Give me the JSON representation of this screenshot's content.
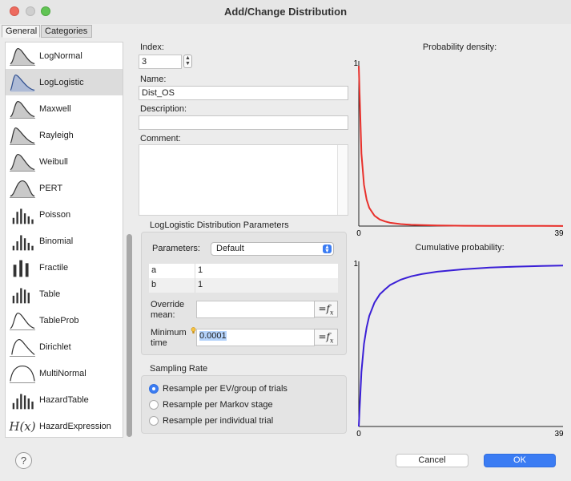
{
  "window": {
    "title": "Add/Change Distribution"
  },
  "tabs": [
    {
      "label": "General"
    },
    {
      "label": "Categories"
    }
  ],
  "distributions": [
    {
      "label": "LogNormal",
      "icon": "lognormal-curve-icon"
    },
    {
      "label": "LogLogistic",
      "icon": "loglogistic-curve-icon",
      "selected": true
    },
    {
      "label": "Maxwell",
      "icon": "maxwell-curve-icon"
    },
    {
      "label": "Rayleigh",
      "icon": "rayleigh-curve-icon"
    },
    {
      "label": "Weibull",
      "icon": "weibull-curve-icon"
    },
    {
      "label": "PERT",
      "icon": "pert-curve-icon"
    },
    {
      "label": "Poisson",
      "icon": "poisson-bars-icon"
    },
    {
      "label": "Binomial",
      "icon": "binomial-bars-icon"
    },
    {
      "label": "Fractile",
      "icon": "fractile-bars-icon"
    },
    {
      "label": "Table",
      "icon": "table-bars-icon"
    },
    {
      "label": "TableProb",
      "icon": "tableprob-curve-icon"
    },
    {
      "label": "Dirichlet",
      "icon": "dirichlet-curve-icon"
    },
    {
      "label": "MultiNormal",
      "icon": "multinormal-curve-icon"
    },
    {
      "label": "HazardTable",
      "icon": "hazardtable-bars-icon"
    },
    {
      "label": "HazardExpression",
      "icon": "hazard-expression-icon",
      "icon_text": "H(x)"
    }
  ],
  "form": {
    "index_label": "Index:",
    "index_value": "3",
    "name_label": "Name:",
    "name_value": "Dist_OS",
    "description_label": "Description:",
    "description_value": "",
    "comment_label": "Comment:",
    "comment_value": ""
  },
  "params": {
    "group_title": "LogLogistic Distribution Parameters",
    "parameters_label": "Parameters:",
    "parameters_value": "Default",
    "rows": [
      {
        "name": "a",
        "value": "1"
      },
      {
        "name": "b",
        "value": "1"
      }
    ],
    "override_mean_label_1": "Override",
    "override_mean_label_2": "mean:",
    "override_mean_value": "",
    "min_time_label_1": "Minimum",
    "min_time_label_2": "time",
    "min_time_value": "0.0001",
    "fx_label": "=fx"
  },
  "sampling": {
    "title": "Sampling Rate",
    "options": [
      {
        "label": "Resample per EV/group of trials",
        "selected": true
      },
      {
        "label": "Resample per Markov stage",
        "selected": false
      },
      {
        "label": "Resample per individual trial",
        "selected": false
      }
    ]
  },
  "chart_data": [
    {
      "type": "line",
      "title": "Probability density:",
      "xlim": [
        0,
        39
      ],
      "ylim": [
        0,
        1
      ],
      "x_tick_labels": [
        "0",
        "39"
      ],
      "y_tick_labels": [
        "1"
      ],
      "color": "#e8302b",
      "x": [
        0,
        0.5,
        1,
        1.5,
        2,
        3,
        4,
        5,
        6,
        8,
        10,
        12,
        15,
        20,
        25,
        30,
        35,
        39
      ],
      "y": [
        0.97,
        0.44,
        0.25,
        0.16,
        0.11,
        0.0625,
        0.04,
        0.028,
        0.02,
        0.012,
        0.008,
        0.006,
        0.004,
        0.002,
        0.0015,
        0.001,
        0.0008,
        0.0006
      ]
    },
    {
      "type": "line",
      "title": "Cumulative probability:",
      "xlim": [
        0,
        39
      ],
      "ylim": [
        0,
        1
      ],
      "x_tick_labels": [
        "0",
        "39"
      ],
      "y_tick_labels": [
        "1"
      ],
      "color": "#3a1fd6",
      "x": [
        0,
        0.5,
        1,
        1.5,
        2,
        3,
        4,
        5,
        6,
        8,
        10,
        12,
        15,
        20,
        25,
        30,
        35,
        39
      ],
      "y": [
        0,
        0.33,
        0.5,
        0.6,
        0.67,
        0.75,
        0.8,
        0.83,
        0.857,
        0.889,
        0.909,
        0.923,
        0.9375,
        0.952,
        0.962,
        0.968,
        0.972,
        0.975
      ]
    }
  ],
  "buttons": {
    "help": "?",
    "cancel": "Cancel",
    "ok": "OK"
  }
}
